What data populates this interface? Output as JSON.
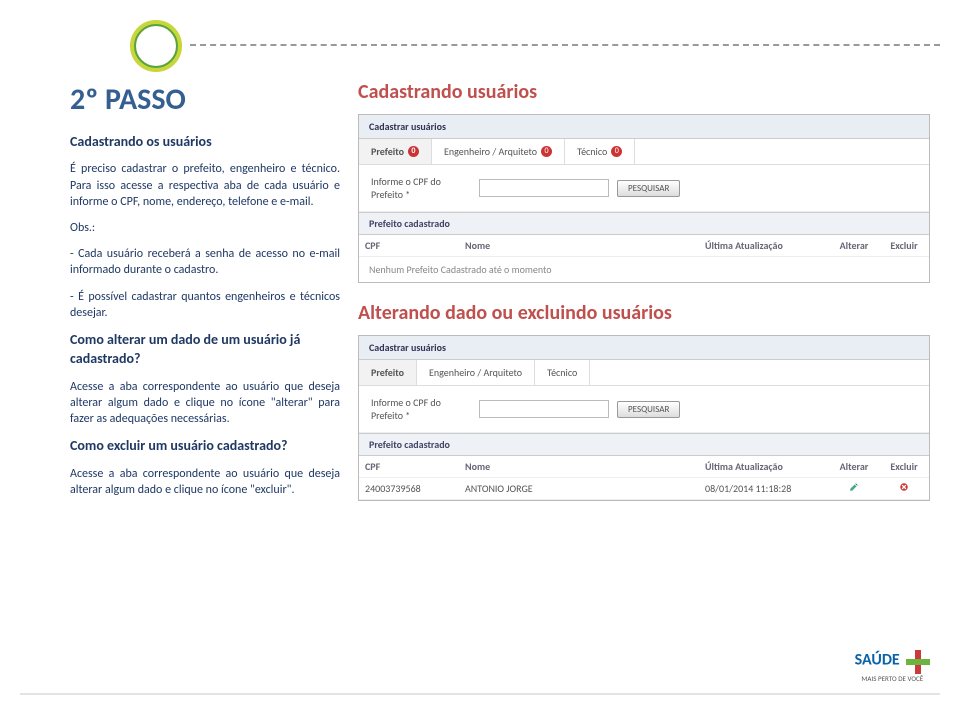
{
  "left": {
    "step_title": "2º PASSO",
    "subheading": "Cadastrando os usuários",
    "p1": "É preciso cadastrar o prefeito, engenheiro e técnico. Para isso acesse a respectiva aba de cada usuário e informe o CPF, nome, endereço, telefone e e-mail.",
    "obs_label": "Obs.:",
    "obs1": "- Cada usuário receberá a senha de acesso no e-mail informado durante o cadastro.",
    "obs2": "- É possível cadastrar quantos engenheiros e técnicos desejar.",
    "q1": "Como alterar um dado de um usuário já cadastrado?",
    "a1": "Acesse a aba correspondente ao usuário que deseja alterar algum dado e clique no ícone \"alterar\" para fazer as adequações necessárias.",
    "q2": "Como excluir um usuário cadastrado?",
    "a2": "Acesse a aba correspondente ao usuário que deseja alterar algum dado e clique no ícone \"excluir\"."
  },
  "right": {
    "heading1": "Cadastrando usuários",
    "heading2": "Alterando dado ou excluindo usuários"
  },
  "screenshot": {
    "panel_title": "Cadastrar usuários",
    "tabs": {
      "t0": "Prefeito",
      "t1": "Engenheiro / Arquiteto",
      "t2": "Técnico"
    },
    "badge0": "0",
    "badge1": "0",
    "badge2": "0",
    "form_label": "Informe o CPF do Prefeito *",
    "search_btn": "PESQUISAR",
    "subheader": "Prefeito cadastrado",
    "cols": {
      "cpf": "CPF",
      "nome": "Nome",
      "upd": "Última Atualização",
      "alt": "Alterar",
      "exc": "Excluir"
    },
    "empty": "Nenhum Prefeito Cadastrado até o momento",
    "row": {
      "cpf": "24003739568",
      "nome": "ANTONIO JORGE",
      "upd": "08/01/2014 11:18:28"
    }
  },
  "logo": {
    "brand": "SAÚDE",
    "tag": "MAIS PERTO DE VOCÊ"
  }
}
